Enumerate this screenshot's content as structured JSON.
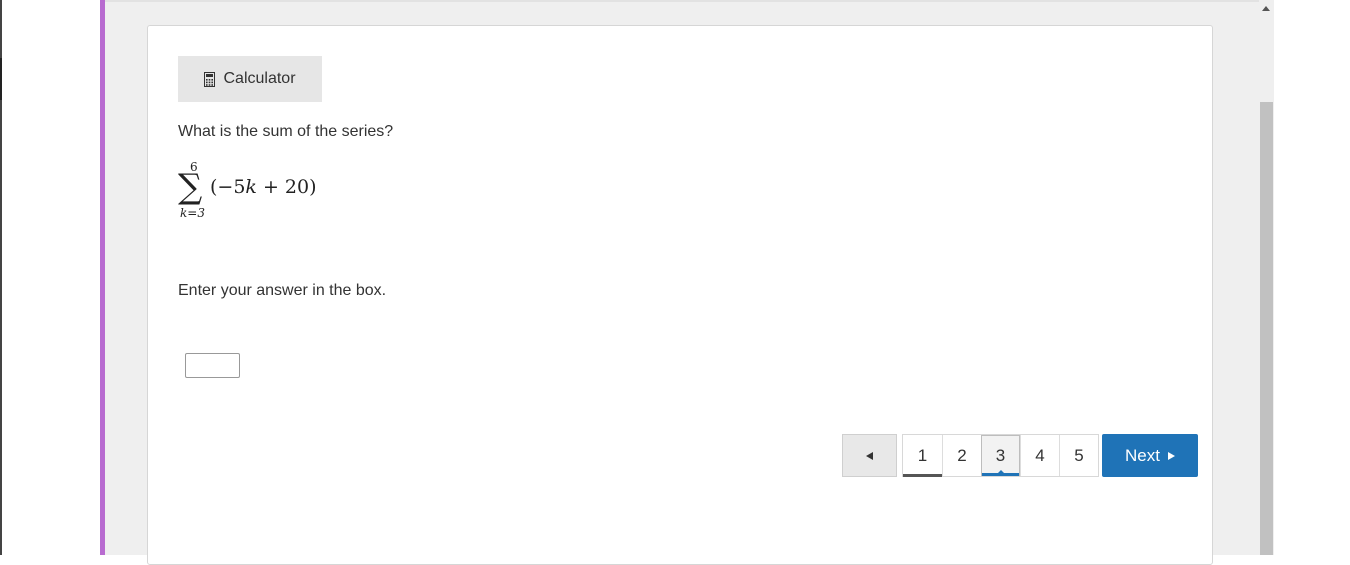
{
  "calculator": {
    "label": "Calculator",
    "icon": "calculator-icon"
  },
  "question": {
    "prompt": "What is the sum of the series?",
    "series": {
      "upper_limit": "6",
      "lower_limit": "k=3",
      "summand_open": "(−5",
      "summand_var": "k",
      "summand_close": " + 20)"
    },
    "instruction": "Enter your answer in the box.",
    "answer_value": ""
  },
  "pagination": {
    "prev_icon": "triangle-left-icon",
    "pages": [
      {
        "label": "1",
        "state": "visited"
      },
      {
        "label": "2",
        "state": "unvisited"
      },
      {
        "label": "3",
        "state": "current"
      },
      {
        "label": "4",
        "state": "unvisited"
      },
      {
        "label": "5",
        "state": "unvisited"
      }
    ],
    "next_label": "Next",
    "next_icon": "triangle-right-icon"
  },
  "colors": {
    "accent_bar": "#b86bd0",
    "primary": "#1f73b7"
  }
}
